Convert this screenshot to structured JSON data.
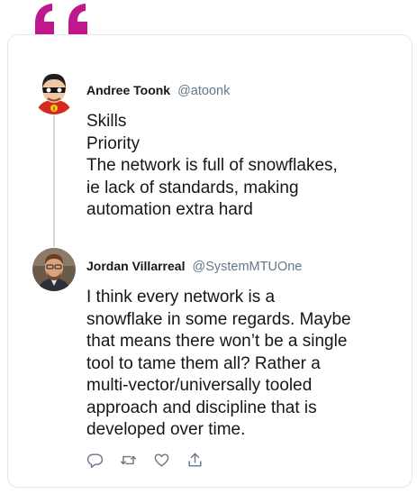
{
  "colors": {
    "quote_accent": "#c1178d",
    "card_border": "#e1e8ed",
    "handle_gray": "#657786",
    "text_dark": "#14171a",
    "icon_gray": "#657786"
  },
  "tweets": [
    {
      "name": "Andree Toonk",
      "handle": "@atoonk",
      "lines": [
        "Skills",
        "Priority",
        "The network is full of snowflakes,",
        "ie lack of standards, making",
        "automation extra hard"
      ]
    },
    {
      "name": "Jordan Villarreal",
      "handle": "@SystemMTUOne",
      "lines": [
        "I think every network is a",
        "snowflake in some regards. Maybe",
        "that means there won’t be a single",
        "tool to tame them all? Rather a",
        "multi-vector/universally tooled",
        "approach and discipline that is",
        "developed over time."
      ]
    }
  ],
  "actions": [
    {
      "icon": "reply-icon"
    },
    {
      "icon": "retweet-icon"
    },
    {
      "icon": "like-icon"
    },
    {
      "icon": "share-icon"
    }
  ]
}
